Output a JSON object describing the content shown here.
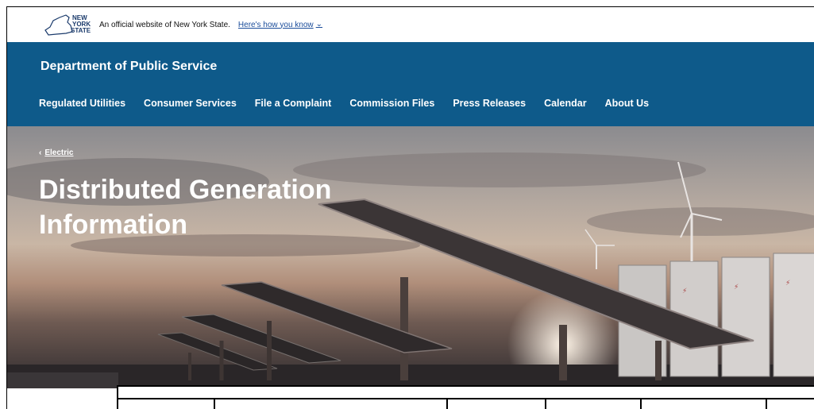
{
  "official_bar": {
    "logo_alt": "NEW YORK STATE",
    "logo_lines": [
      "NEW",
      "YORK",
      "STATE"
    ],
    "text": "An official website of New York State.",
    "how_know": "Here's how you know"
  },
  "header": {
    "title": "Department of Public Service",
    "nav": [
      "Regulated Utilities",
      "Consumer Services",
      "File a Complaint",
      "Commission Files",
      "Press Releases",
      "Calendar",
      "About Us"
    ]
  },
  "hero": {
    "breadcrumb_label": "Electric",
    "title": "Distributed Generation Information"
  },
  "colors": {
    "header_blue": "#0e5a8a",
    "link_blue": "#1a4c9a"
  }
}
